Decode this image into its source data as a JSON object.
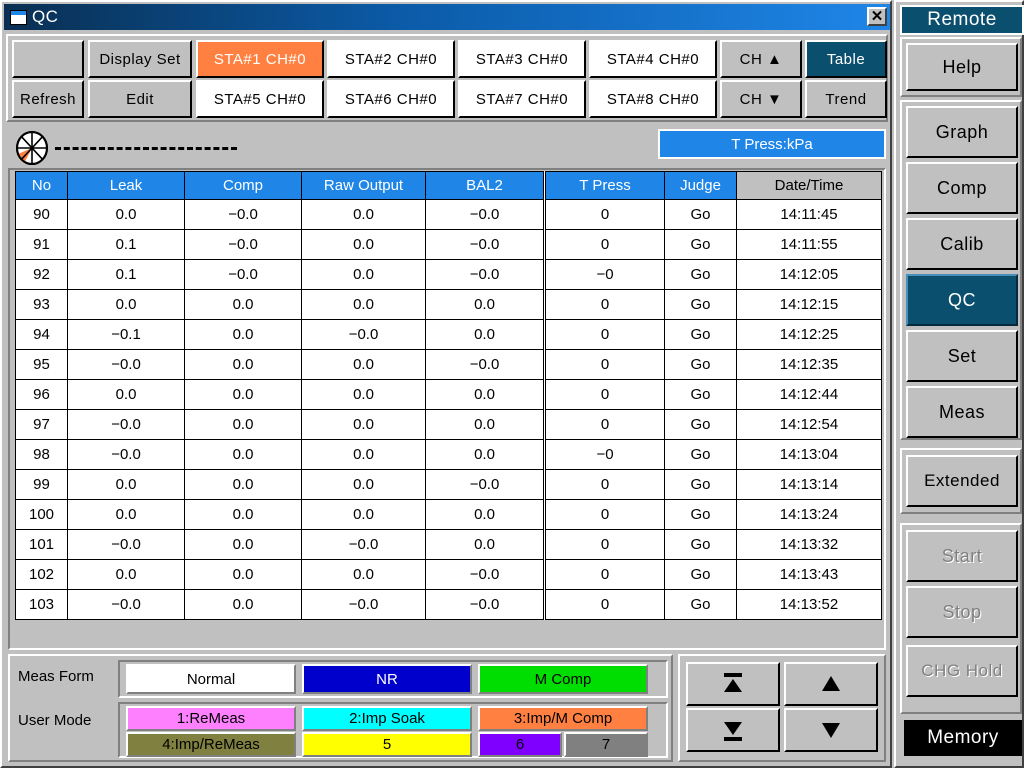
{
  "window": {
    "title": "QC",
    "icon": "window-icon",
    "close_label": "✕"
  },
  "toolbar": {
    "blank_label": "",
    "refresh_label": "Refresh",
    "display_set_label": "Display Set",
    "edit_label": "Edit",
    "stations": [
      "STA#1 CH#0",
      "STA#2 CH#0",
      "STA#3 CH#0",
      "STA#4 CH#0",
      "STA#5 CH#0",
      "STA#6 CH#0",
      "STA#7 CH#0",
      "STA#8 CH#0"
    ],
    "active_station": "STA#1 CH#0",
    "ch_up_label": "CH ▲",
    "ch_down_label": "CH ▼",
    "table_label": "Table",
    "trend_label": "Trend"
  },
  "statusbar": {
    "wheel_icon": "pie-wheel-icon",
    "dash_line": "------------------",
    "tpress_unit_label": "T Press:kPa"
  },
  "table": {
    "columns": [
      "No",
      "Leak",
      "Comp",
      "Raw Output",
      "BAL2",
      "T Press",
      "Judge",
      "Date/Time"
    ],
    "sorted_column": "Date/Time",
    "rows": [
      [
        "90",
        "0.0",
        "−0.0",
        "0.0",
        "−0.0",
        "0",
        "Go",
        "14:11:45"
      ],
      [
        "91",
        "0.1",
        "−0.0",
        "0.0",
        "−0.0",
        "0",
        "Go",
        "14:11:55"
      ],
      [
        "92",
        "0.1",
        "−0.0",
        "0.0",
        "−0.0",
        "−0",
        "Go",
        "14:12:05"
      ],
      [
        "93",
        "0.0",
        "0.0",
        "0.0",
        "0.0",
        "0",
        "Go",
        "14:12:15"
      ],
      [
        "94",
        "−0.1",
        "0.0",
        "−0.0",
        "0.0",
        "0",
        "Go",
        "14:12:25"
      ],
      [
        "95",
        "−0.0",
        "0.0",
        "0.0",
        "−0.0",
        "0",
        "Go",
        "14:12:35"
      ],
      [
        "96",
        "0.0",
        "0.0",
        "0.0",
        "0.0",
        "0",
        "Go",
        "14:12:44"
      ],
      [
        "97",
        "−0.0",
        "0.0",
        "0.0",
        "0.0",
        "0",
        "Go",
        "14:12:54"
      ],
      [
        "98",
        "−0.0",
        "0.0",
        "0.0",
        "0.0",
        "−0",
        "Go",
        "14:13:04"
      ],
      [
        "99",
        "0.0",
        "0.0",
        "0.0",
        "−0.0",
        "0",
        "Go",
        "14:13:14"
      ],
      [
        "100",
        "0.0",
        "0.0",
        "0.0",
        "0.0",
        "0",
        "Go",
        "14:13:24"
      ],
      [
        "101",
        "−0.0",
        "0.0",
        "−0.0",
        "0.0",
        "0",
        "Go",
        "14:13:32"
      ],
      [
        "102",
        "0.0",
        "0.0",
        "0.0",
        "−0.0",
        "0",
        "Go",
        "14:13:43"
      ],
      [
        "103",
        "−0.0",
        "0.0",
        "−0.0",
        "−0.0",
        "0",
        "Go",
        "14:13:52"
      ]
    ]
  },
  "meas_form": {
    "label": "Meas Form",
    "buttons": [
      {
        "label": "Normal",
        "bg": "#ffffff",
        "fg": "#000000"
      },
      {
        "label": "NR",
        "bg": "#0000cc",
        "fg": "#ffffff"
      },
      {
        "label": "M Comp",
        "bg": "#00dd00",
        "fg": "#000000"
      }
    ]
  },
  "user_mode": {
    "label": "User Mode",
    "buttons": [
      {
        "label": "1:ReMeas",
        "bg": "#ff80ff",
        "fg": "#000000"
      },
      {
        "label": "2:Imp Soak",
        "bg": "#00ffff",
        "fg": "#000000"
      },
      {
        "label": "3:Imp/M Comp",
        "bg": "#ff8040",
        "fg": "#000000"
      },
      {
        "label": "4:Imp/ReMeas",
        "bg": "#808040",
        "fg": "#000000"
      },
      {
        "label": "5",
        "bg": "#ffff00",
        "fg": "#000000"
      },
      {
        "label": "6",
        "bg": "#8000ff",
        "fg": "#000000"
      },
      {
        "label": "7",
        "bg": "#808080",
        "fg": "#000000"
      }
    ]
  },
  "nav": {
    "top_label": "▲",
    "up_label": "▲",
    "bottom_label": "▼",
    "down_label": "▼"
  },
  "sidebar": {
    "header": "Remote",
    "groups": [
      {
        "items": [
          {
            "label": "Help",
            "state": "normal"
          }
        ]
      },
      {
        "items": [
          {
            "label": "Graph",
            "state": "normal"
          },
          {
            "label": "Comp",
            "state": "normal"
          },
          {
            "label": "Calib",
            "state": "normal"
          },
          {
            "label": "QC",
            "state": "active"
          },
          {
            "label": "Set",
            "state": "normal"
          },
          {
            "label": "Meas",
            "state": "normal"
          }
        ]
      },
      {
        "items": [
          {
            "label": "Extended",
            "state": "normal"
          }
        ]
      },
      {
        "items": [
          {
            "label": "Start",
            "state": "disabled"
          },
          {
            "label": "Stop",
            "state": "disabled"
          },
          {
            "label": "CHG Hold",
            "state": "disabled"
          }
        ]
      }
    ],
    "memory_label": "Memory"
  },
  "colors": {
    "accent_blue": "#1f86e8",
    "title_dark": "#0a2f52",
    "teal": "#0b4f6e",
    "orange": "#ff8040",
    "face": "#c0c0c0"
  }
}
